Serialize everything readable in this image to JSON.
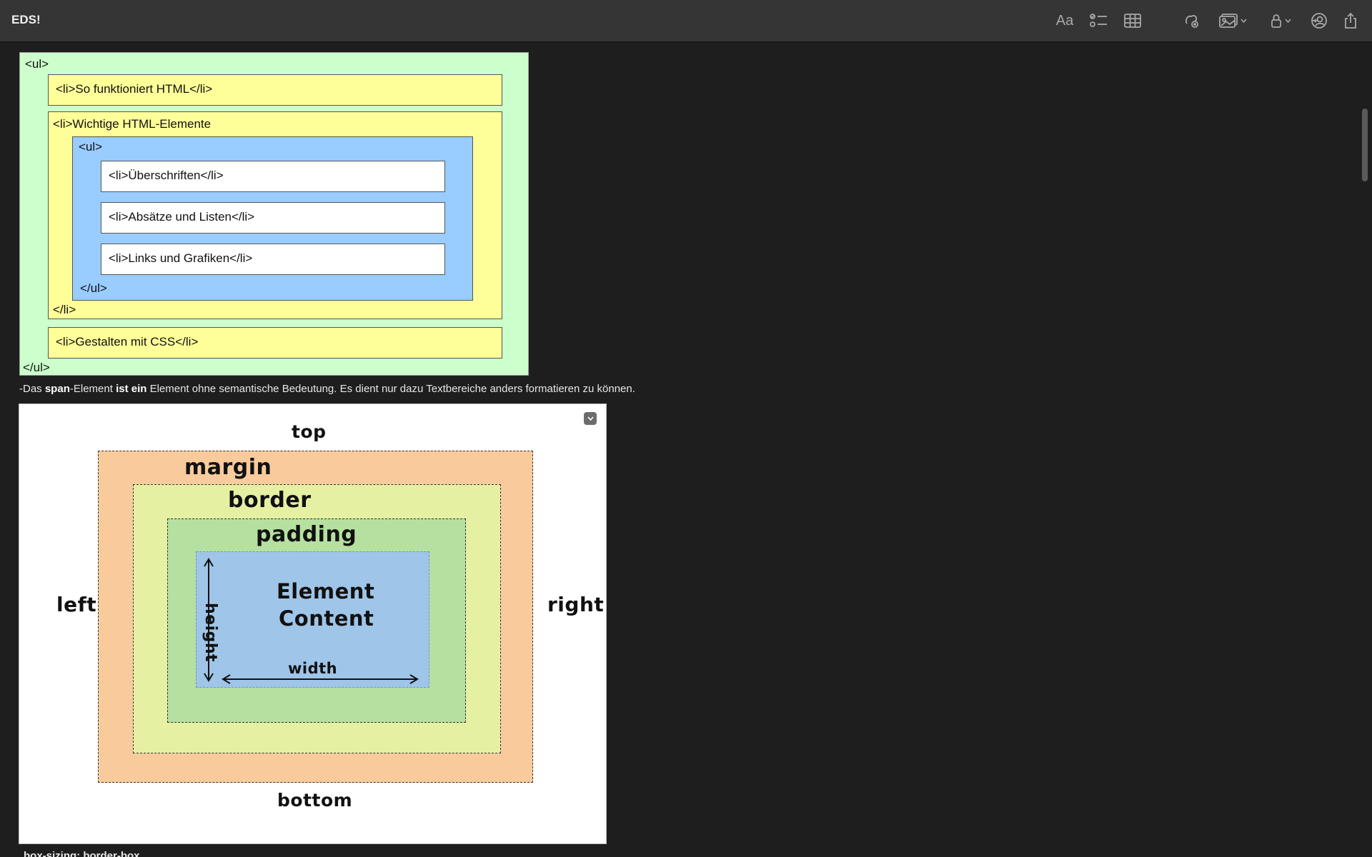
{
  "window": {
    "title": "EDS!"
  },
  "toolbar": {
    "icons": [
      "format-icon",
      "checklist-icon",
      "table-icon",
      "collaborate-icon",
      "media-icon",
      "lock-icon",
      "share-avatar-icon",
      "share-icon"
    ],
    "format_label": "Aa"
  },
  "diagram_list": {
    "ul_open": "<ul>",
    "item1": "<li>So funktioniert HTML</li>",
    "item2_open": "<li>Wichtige HTML-Elemente",
    "inner_ul_open": "<ul>",
    "sub1": "<li>Überschriften</li>",
    "sub2": "<li>Absätze und Listen</li>",
    "sub3": "<li>Links und Grafiken</li>",
    "inner_ul_close": "</ul>",
    "item2_close": "</li>",
    "item3": "<li>Gestalten mit CSS</li>",
    "ul_close": "</ul>",
    "colors": {
      "outer": "#ccffcc",
      "li": "#ffff99",
      "inner_ul": "#99ccff",
      "sub_li": "#ffffff"
    }
  },
  "paragraph": {
    "prefix": "-Das ",
    "b1": "span",
    "mid": "-Element ",
    "b2": "ist ein",
    "rest": " Element ohne semantische Bedeutung. Es dient nur dazu Textbereiche anders formatieren zu können."
  },
  "box_model": {
    "top": "top",
    "margin": "margin",
    "border": "border",
    "padding": "padding",
    "left": "left",
    "right": "right",
    "content_line1": "Element",
    "content_line2": "Content",
    "height": "height",
    "width": "width",
    "bottom": "bottom",
    "colors": {
      "margin": "#f9cb9c",
      "border": "#e6f0a3",
      "padding": "#b6e0a0",
      "content": "#9fc5e8"
    }
  },
  "partial_text": "box-sizing: border-box"
}
